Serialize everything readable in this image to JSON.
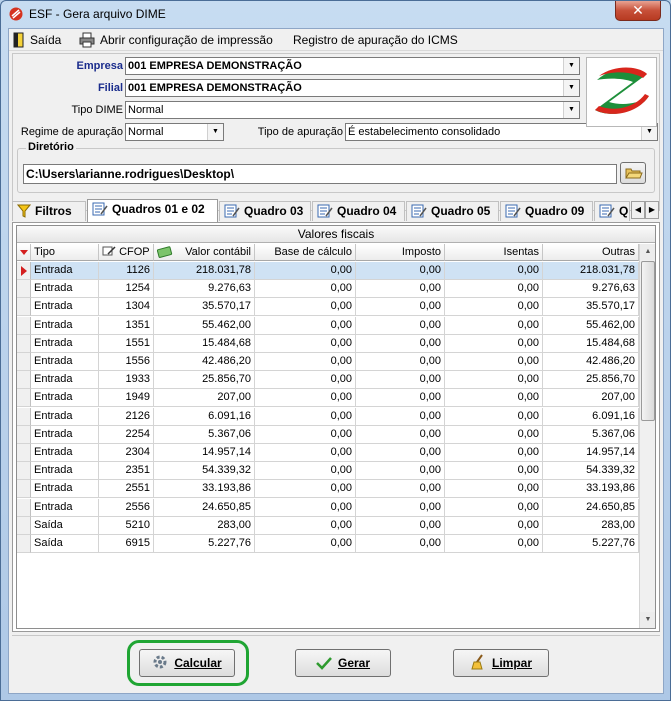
{
  "window": {
    "title": "ESF - Gera arquivo DIME",
    "close_label": "✕"
  },
  "menu": {
    "exit": "Saída",
    "print_config": "Abrir configuração de impressão",
    "icms_register": "Registro de apuração do ICMS"
  },
  "form": {
    "empresa_label": "Empresa",
    "empresa_value": "001   EMPRESA DEMONSTRAÇÃO",
    "filial_label": "Filial",
    "filial_value": "001   EMPRESA DEMONSTRAÇÃO",
    "tipo_dime_label": "Tipo DIME",
    "tipo_dime_value": "Normal",
    "regime_label": "Regime de apuração",
    "regime_value": "Normal",
    "tipo_apuracao_label": "Tipo de apuração",
    "tipo_apuracao_value": "É estabelecimento consolidado",
    "diretorio_label": "Diretório",
    "diretorio_value": "C:\\Users\\arianne.rodrigues\\Desktop\\"
  },
  "tabs": [
    {
      "label": "Filtros",
      "icon": "filter-icon"
    },
    {
      "label": "Quadros 01 e 02",
      "icon": "form-edit-icon"
    },
    {
      "label": "Quadro 03",
      "icon": "form-edit-icon"
    },
    {
      "label": "Quadro 04",
      "icon": "form-edit-icon"
    },
    {
      "label": "Quadro 05",
      "icon": "form-edit-icon"
    },
    {
      "label": "Quadro 09",
      "icon": "form-edit-icon"
    },
    {
      "label": "Q",
      "icon": "form-edit-icon"
    }
  ],
  "grid": {
    "title": "Valores fiscais",
    "columns": [
      "Tipo",
      "CFOP",
      "Valor contábil",
      "Base de cálculo",
      "Imposto",
      "Isentas",
      "Outras"
    ],
    "rows": [
      [
        "Entrada",
        "1126",
        "218.031,78",
        "0,00",
        "0,00",
        "0,00",
        "218.031,78"
      ],
      [
        "Entrada",
        "1254",
        "9.276,63",
        "0,00",
        "0,00",
        "0,00",
        "9.276,63"
      ],
      [
        "Entrada",
        "1304",
        "35.570,17",
        "0,00",
        "0,00",
        "0,00",
        "35.570,17"
      ],
      [
        "Entrada",
        "1351",
        "55.462,00",
        "0,00",
        "0,00",
        "0,00",
        "55.462,00"
      ],
      [
        "Entrada",
        "1551",
        "15.484,68",
        "0,00",
        "0,00",
        "0,00",
        "15.484,68"
      ],
      [
        "Entrada",
        "1556",
        "42.486,20",
        "0,00",
        "0,00",
        "0,00",
        "42.486,20"
      ],
      [
        "Entrada",
        "1933",
        "25.856,70",
        "0,00",
        "0,00",
        "0,00",
        "25.856,70"
      ],
      [
        "Entrada",
        "1949",
        "207,00",
        "0,00",
        "0,00",
        "0,00",
        "207,00"
      ],
      [
        "Entrada",
        "2126",
        "6.091,16",
        "0,00",
        "0,00",
        "0,00",
        "6.091,16"
      ],
      [
        "Entrada",
        "2254",
        "5.367,06",
        "0,00",
        "0,00",
        "0,00",
        "5.367,06"
      ],
      [
        "Entrada",
        "2304",
        "14.957,14",
        "0,00",
        "0,00",
        "0,00",
        "14.957,14"
      ],
      [
        "Entrada",
        "2351",
        "54.339,32",
        "0,00",
        "0,00",
        "0,00",
        "54.339,32"
      ],
      [
        "Entrada",
        "2551",
        "33.193,86",
        "0,00",
        "0,00",
        "0,00",
        "33.193,86"
      ],
      [
        "Entrada",
        "2556",
        "24.650,85",
        "0,00",
        "0,00",
        "0,00",
        "24.650,85"
      ],
      [
        "Saída",
        "5210",
        "283,00",
        "0,00",
        "0,00",
        "0,00",
        "283,00"
      ],
      [
        "Saída",
        "6915",
        "5.227,76",
        "0,00",
        "0,00",
        "0,00",
        "5.227,76"
      ]
    ]
  },
  "buttons": {
    "calcular": "Calcular",
    "gerar": "Gerar",
    "limpar": "Limpar"
  },
  "colors": {
    "highlight": "#1fa533",
    "label_blue": "#1a2c8c",
    "selected_row": "#cfe2f4",
    "title_red": "#c75039"
  }
}
